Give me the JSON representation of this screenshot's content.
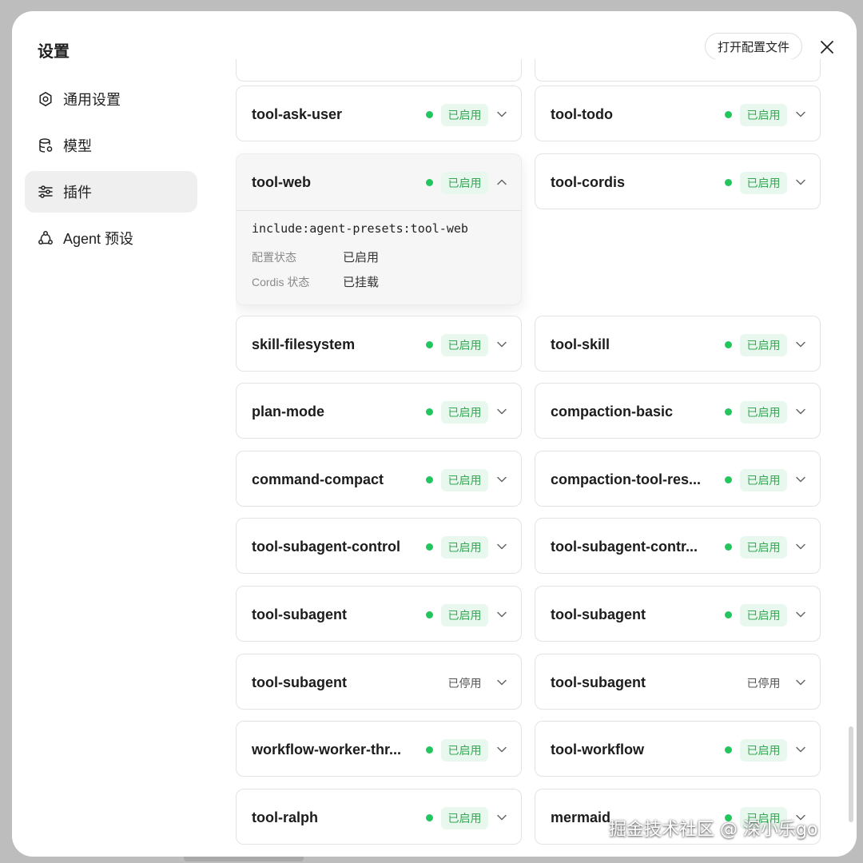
{
  "window": {
    "title": "设置",
    "open_config_label": "打开配置文件"
  },
  "nav": [
    {
      "label": "通用设置",
      "icon": "gear-icon",
      "active": false
    },
    {
      "label": "模型",
      "icon": "database-icon",
      "active": false
    },
    {
      "label": "插件",
      "icon": "sliders-icon",
      "active": true
    },
    {
      "label": "Agent 预设",
      "icon": "agent-icon",
      "active": false
    }
  ],
  "plugins": [
    {
      "name": "tool-ask-user",
      "status": "已启用",
      "enabled": true
    },
    {
      "name": "tool-todo",
      "status": "已启用",
      "enabled": true
    },
    {
      "name": "tool-web",
      "status": "已启用",
      "enabled": true,
      "expanded": true
    },
    {
      "name": "tool-cordis",
      "status": "已启用",
      "enabled": true
    },
    {
      "name": "skill-filesystem",
      "status": "已启用",
      "enabled": true
    },
    {
      "name": "tool-skill",
      "status": "已启用",
      "enabled": true
    },
    {
      "name": "plan-mode",
      "status": "已启用",
      "enabled": true
    },
    {
      "name": "compaction-basic",
      "status": "已启用",
      "enabled": true
    },
    {
      "name": "command-compact",
      "status": "已启用",
      "enabled": true
    },
    {
      "name": "compaction-tool-res...",
      "status": "已启用",
      "enabled": true
    },
    {
      "name": "tool-subagent-control",
      "status": "已启用",
      "enabled": true
    },
    {
      "name": "tool-subagent-contr...",
      "status": "已启用",
      "enabled": true
    },
    {
      "name": "tool-subagent",
      "status": "已启用",
      "enabled": true
    },
    {
      "name": "tool-subagent",
      "status": "已启用",
      "enabled": true
    },
    {
      "name": "tool-subagent",
      "status": "已停用",
      "enabled": false
    },
    {
      "name": "tool-subagent",
      "status": "已停用",
      "enabled": false
    },
    {
      "name": "workflow-worker-thr...",
      "status": "已启用",
      "enabled": true
    },
    {
      "name": "tool-workflow",
      "status": "已启用",
      "enabled": true
    },
    {
      "name": "tool-ralph",
      "status": "已启用",
      "enabled": true
    },
    {
      "name": "mermaid",
      "status": "已启用",
      "enabled": true
    }
  ],
  "expanded_detail": {
    "path": "include:agent-presets:tool-web",
    "config_status_label": "配置状态",
    "config_status_value": "已启用",
    "cordis_status_label": "Cordis 状态",
    "cordis_status_value": "已挂载"
  },
  "watermark": "掘金技术社区 @ 深小乐go",
  "colors": {
    "enabled_dot": "#22c55e",
    "enabled_badge_bg": "#e9f8ee",
    "enabled_badge_text": "#34a853",
    "active_nav_bg": "#efefef"
  }
}
